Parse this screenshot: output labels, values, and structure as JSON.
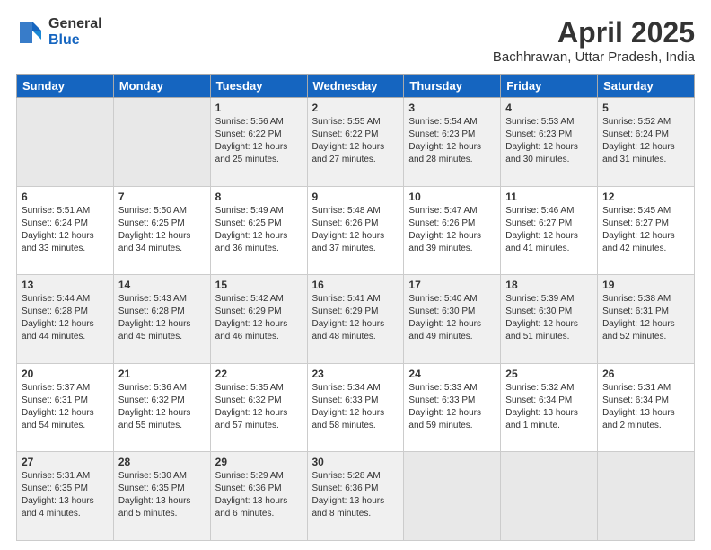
{
  "logo": {
    "general": "General",
    "blue": "Blue"
  },
  "title": "April 2025",
  "subtitle": "Bachhrawan, Uttar Pradesh, India",
  "days_header": [
    "Sunday",
    "Monday",
    "Tuesday",
    "Wednesday",
    "Thursday",
    "Friday",
    "Saturday"
  ],
  "weeks": [
    [
      {
        "num": "",
        "detail": "",
        "empty": true
      },
      {
        "num": "",
        "detail": "",
        "empty": true
      },
      {
        "num": "1",
        "detail": "Sunrise: 5:56 AM\nSunset: 6:22 PM\nDaylight: 12 hours and 25 minutes."
      },
      {
        "num": "2",
        "detail": "Sunrise: 5:55 AM\nSunset: 6:22 PM\nDaylight: 12 hours and 27 minutes."
      },
      {
        "num": "3",
        "detail": "Sunrise: 5:54 AM\nSunset: 6:23 PM\nDaylight: 12 hours and 28 minutes."
      },
      {
        "num": "4",
        "detail": "Sunrise: 5:53 AM\nSunset: 6:23 PM\nDaylight: 12 hours and 30 minutes."
      },
      {
        "num": "5",
        "detail": "Sunrise: 5:52 AM\nSunset: 6:24 PM\nDaylight: 12 hours and 31 minutes."
      }
    ],
    [
      {
        "num": "6",
        "detail": "Sunrise: 5:51 AM\nSunset: 6:24 PM\nDaylight: 12 hours and 33 minutes."
      },
      {
        "num": "7",
        "detail": "Sunrise: 5:50 AM\nSunset: 6:25 PM\nDaylight: 12 hours and 34 minutes."
      },
      {
        "num": "8",
        "detail": "Sunrise: 5:49 AM\nSunset: 6:25 PM\nDaylight: 12 hours and 36 minutes."
      },
      {
        "num": "9",
        "detail": "Sunrise: 5:48 AM\nSunset: 6:26 PM\nDaylight: 12 hours and 37 minutes."
      },
      {
        "num": "10",
        "detail": "Sunrise: 5:47 AM\nSunset: 6:26 PM\nDaylight: 12 hours and 39 minutes."
      },
      {
        "num": "11",
        "detail": "Sunrise: 5:46 AM\nSunset: 6:27 PM\nDaylight: 12 hours and 41 minutes."
      },
      {
        "num": "12",
        "detail": "Sunrise: 5:45 AM\nSunset: 6:27 PM\nDaylight: 12 hours and 42 minutes."
      }
    ],
    [
      {
        "num": "13",
        "detail": "Sunrise: 5:44 AM\nSunset: 6:28 PM\nDaylight: 12 hours and 44 minutes."
      },
      {
        "num": "14",
        "detail": "Sunrise: 5:43 AM\nSunset: 6:28 PM\nDaylight: 12 hours and 45 minutes."
      },
      {
        "num": "15",
        "detail": "Sunrise: 5:42 AM\nSunset: 6:29 PM\nDaylight: 12 hours and 46 minutes."
      },
      {
        "num": "16",
        "detail": "Sunrise: 5:41 AM\nSunset: 6:29 PM\nDaylight: 12 hours and 48 minutes."
      },
      {
        "num": "17",
        "detail": "Sunrise: 5:40 AM\nSunset: 6:30 PM\nDaylight: 12 hours and 49 minutes."
      },
      {
        "num": "18",
        "detail": "Sunrise: 5:39 AM\nSunset: 6:30 PM\nDaylight: 12 hours and 51 minutes."
      },
      {
        "num": "19",
        "detail": "Sunrise: 5:38 AM\nSunset: 6:31 PM\nDaylight: 12 hours and 52 minutes."
      }
    ],
    [
      {
        "num": "20",
        "detail": "Sunrise: 5:37 AM\nSunset: 6:31 PM\nDaylight: 12 hours and 54 minutes."
      },
      {
        "num": "21",
        "detail": "Sunrise: 5:36 AM\nSunset: 6:32 PM\nDaylight: 12 hours and 55 minutes."
      },
      {
        "num": "22",
        "detail": "Sunrise: 5:35 AM\nSunset: 6:32 PM\nDaylight: 12 hours and 57 minutes."
      },
      {
        "num": "23",
        "detail": "Sunrise: 5:34 AM\nSunset: 6:33 PM\nDaylight: 12 hours and 58 minutes."
      },
      {
        "num": "24",
        "detail": "Sunrise: 5:33 AM\nSunset: 6:33 PM\nDaylight: 12 hours and 59 minutes."
      },
      {
        "num": "25",
        "detail": "Sunrise: 5:32 AM\nSunset: 6:34 PM\nDaylight: 13 hours and 1 minute."
      },
      {
        "num": "26",
        "detail": "Sunrise: 5:31 AM\nSunset: 6:34 PM\nDaylight: 13 hours and 2 minutes."
      }
    ],
    [
      {
        "num": "27",
        "detail": "Sunrise: 5:31 AM\nSunset: 6:35 PM\nDaylight: 13 hours and 4 minutes."
      },
      {
        "num": "28",
        "detail": "Sunrise: 5:30 AM\nSunset: 6:35 PM\nDaylight: 13 hours and 5 minutes."
      },
      {
        "num": "29",
        "detail": "Sunrise: 5:29 AM\nSunset: 6:36 PM\nDaylight: 13 hours and 6 minutes."
      },
      {
        "num": "30",
        "detail": "Sunrise: 5:28 AM\nSunset: 6:36 PM\nDaylight: 13 hours and 8 minutes."
      },
      {
        "num": "",
        "detail": "",
        "empty": true
      },
      {
        "num": "",
        "detail": "",
        "empty": true
      },
      {
        "num": "",
        "detail": "",
        "empty": true
      }
    ]
  ]
}
